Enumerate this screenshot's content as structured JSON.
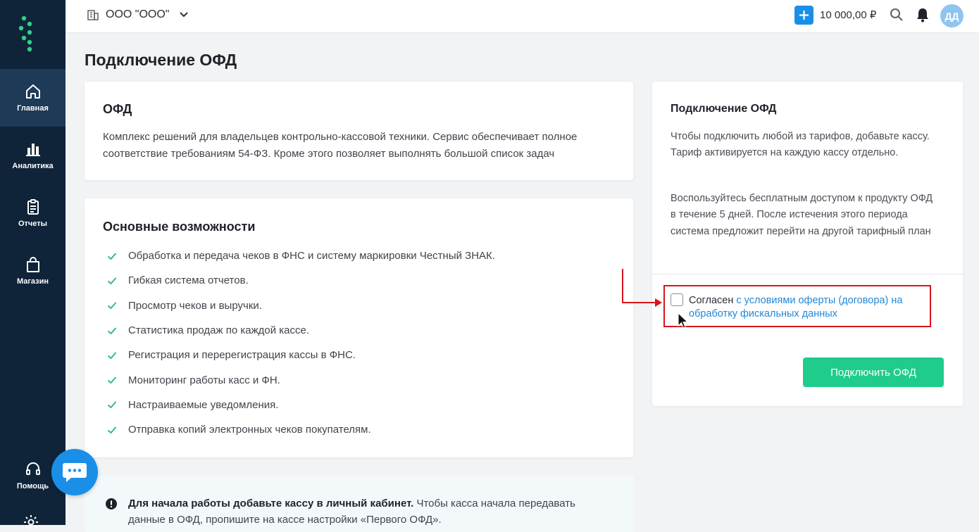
{
  "topbar": {
    "org_name": "ООО \"ООО\"",
    "balance": "10 000,00 ₽",
    "avatar_initials": "ДД"
  },
  "sidebar": {
    "items": [
      {
        "label": "Главная",
        "icon": "home-icon",
        "active": true
      },
      {
        "label": "Аналитика",
        "icon": "bar-chart-icon",
        "active": false
      },
      {
        "label": "Отчеты",
        "icon": "clipboard-icon",
        "active": false
      },
      {
        "label": "Магазин",
        "icon": "shopping-bag-icon",
        "active": false
      }
    ],
    "help_label": "Помощь"
  },
  "page": {
    "title": "Подключение ОФД"
  },
  "ofd_card": {
    "title": "ОФД",
    "description": "Комплекс решений для владельцев контрольно-кассовой техники. Сервис обеспечивает полное соответствие требованиям 54-ФЗ. Кроме этого позволяет выполнять большой список задач"
  },
  "features_card": {
    "title": "Основные возможности",
    "items": [
      "Обработка и передача чеков в ФНС и систему маркировки Честный ЗНАК.",
      "Гибкая система отчетов.",
      "Просмотр чеков и выручки.",
      "Статистика продаж по каждой кассе.",
      "Регистрация и перерегистрация кассы в ФНС.",
      "Мониторинг работы касс и ФН.",
      "Настраиваемые уведомления.",
      "Отправка копий электронных чеков покупателям."
    ]
  },
  "connect_card": {
    "title": "Подключение ОФД",
    "paragraph1": "Чтобы подключить любой из тарифов, добавьте кассу. Тариф активируется на каждую кассу отдельно.",
    "paragraph2": "Воспользуйтесь бесплатным доступом к продукту ОФД в течение 5 дней. После истечения этого периода система предложит перейти на другой тарифный план",
    "agree_prefix": "Согласен ",
    "agree_link": "с условиями оферты (договора) на обработку фискальных данных",
    "agree_checked": false,
    "button_label": "Подключить ОФД"
  },
  "info_card": {
    "bold_text": "Для начала работы добавьте кассу в личный кабинет.",
    "text": " Чтобы касса начала передавать данные в ОФД, пропишите на кассе настройки «Первого ОФД»."
  },
  "colors": {
    "sidebar_bg": "#0f2439",
    "sidebar_active": "#1d3a57",
    "accent_blue": "#1a8fe8",
    "primary_green": "#1fcc8c",
    "highlight_red": "#d8141c",
    "check_green": "#2fbf71"
  }
}
